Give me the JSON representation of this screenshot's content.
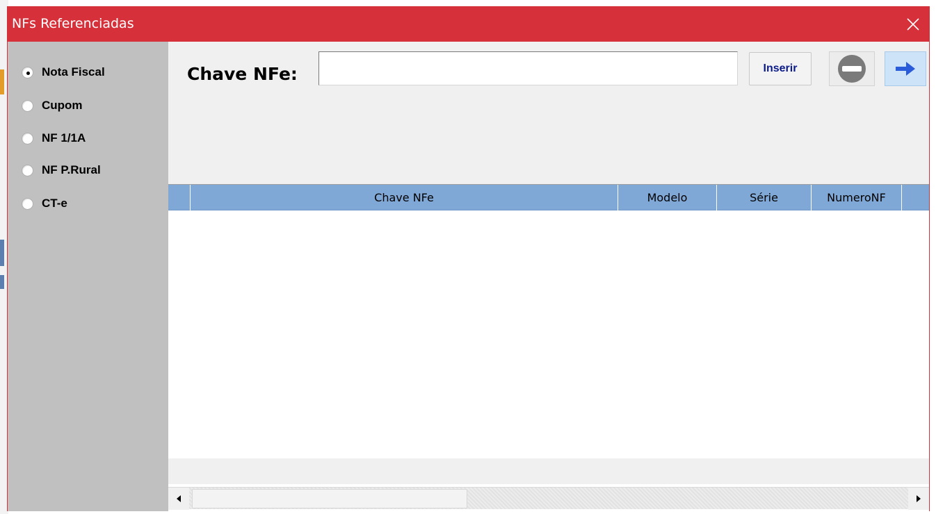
{
  "window": {
    "title": "NFs Referenciadas",
    "close_icon": "close-icon"
  },
  "sidebar": {
    "options": [
      {
        "label": "Nota Fiscal",
        "checked": true
      },
      {
        "label": "Cupom",
        "checked": false
      },
      {
        "label": "NF 1/1A",
        "checked": false
      },
      {
        "label": "NF P.Rural",
        "checked": false
      },
      {
        "label": "CT-e",
        "checked": false
      }
    ]
  },
  "chave": {
    "label": "Chave NFe:",
    "value": ""
  },
  "toolbar": {
    "inserir_label": "Inserir",
    "remove_icon": "remove-icon",
    "arrow_icon": "arrow-right-icon"
  },
  "grid": {
    "columns": [
      "",
      "Chave NFe",
      "Modelo",
      "Série",
      "NumeroNF"
    ],
    "rows": []
  },
  "colors": {
    "titlebar": "#d6313a",
    "sidebar": "#c0c0c0",
    "grid_header": "#80a8d6",
    "inserir_text": "#0a1a8a"
  }
}
